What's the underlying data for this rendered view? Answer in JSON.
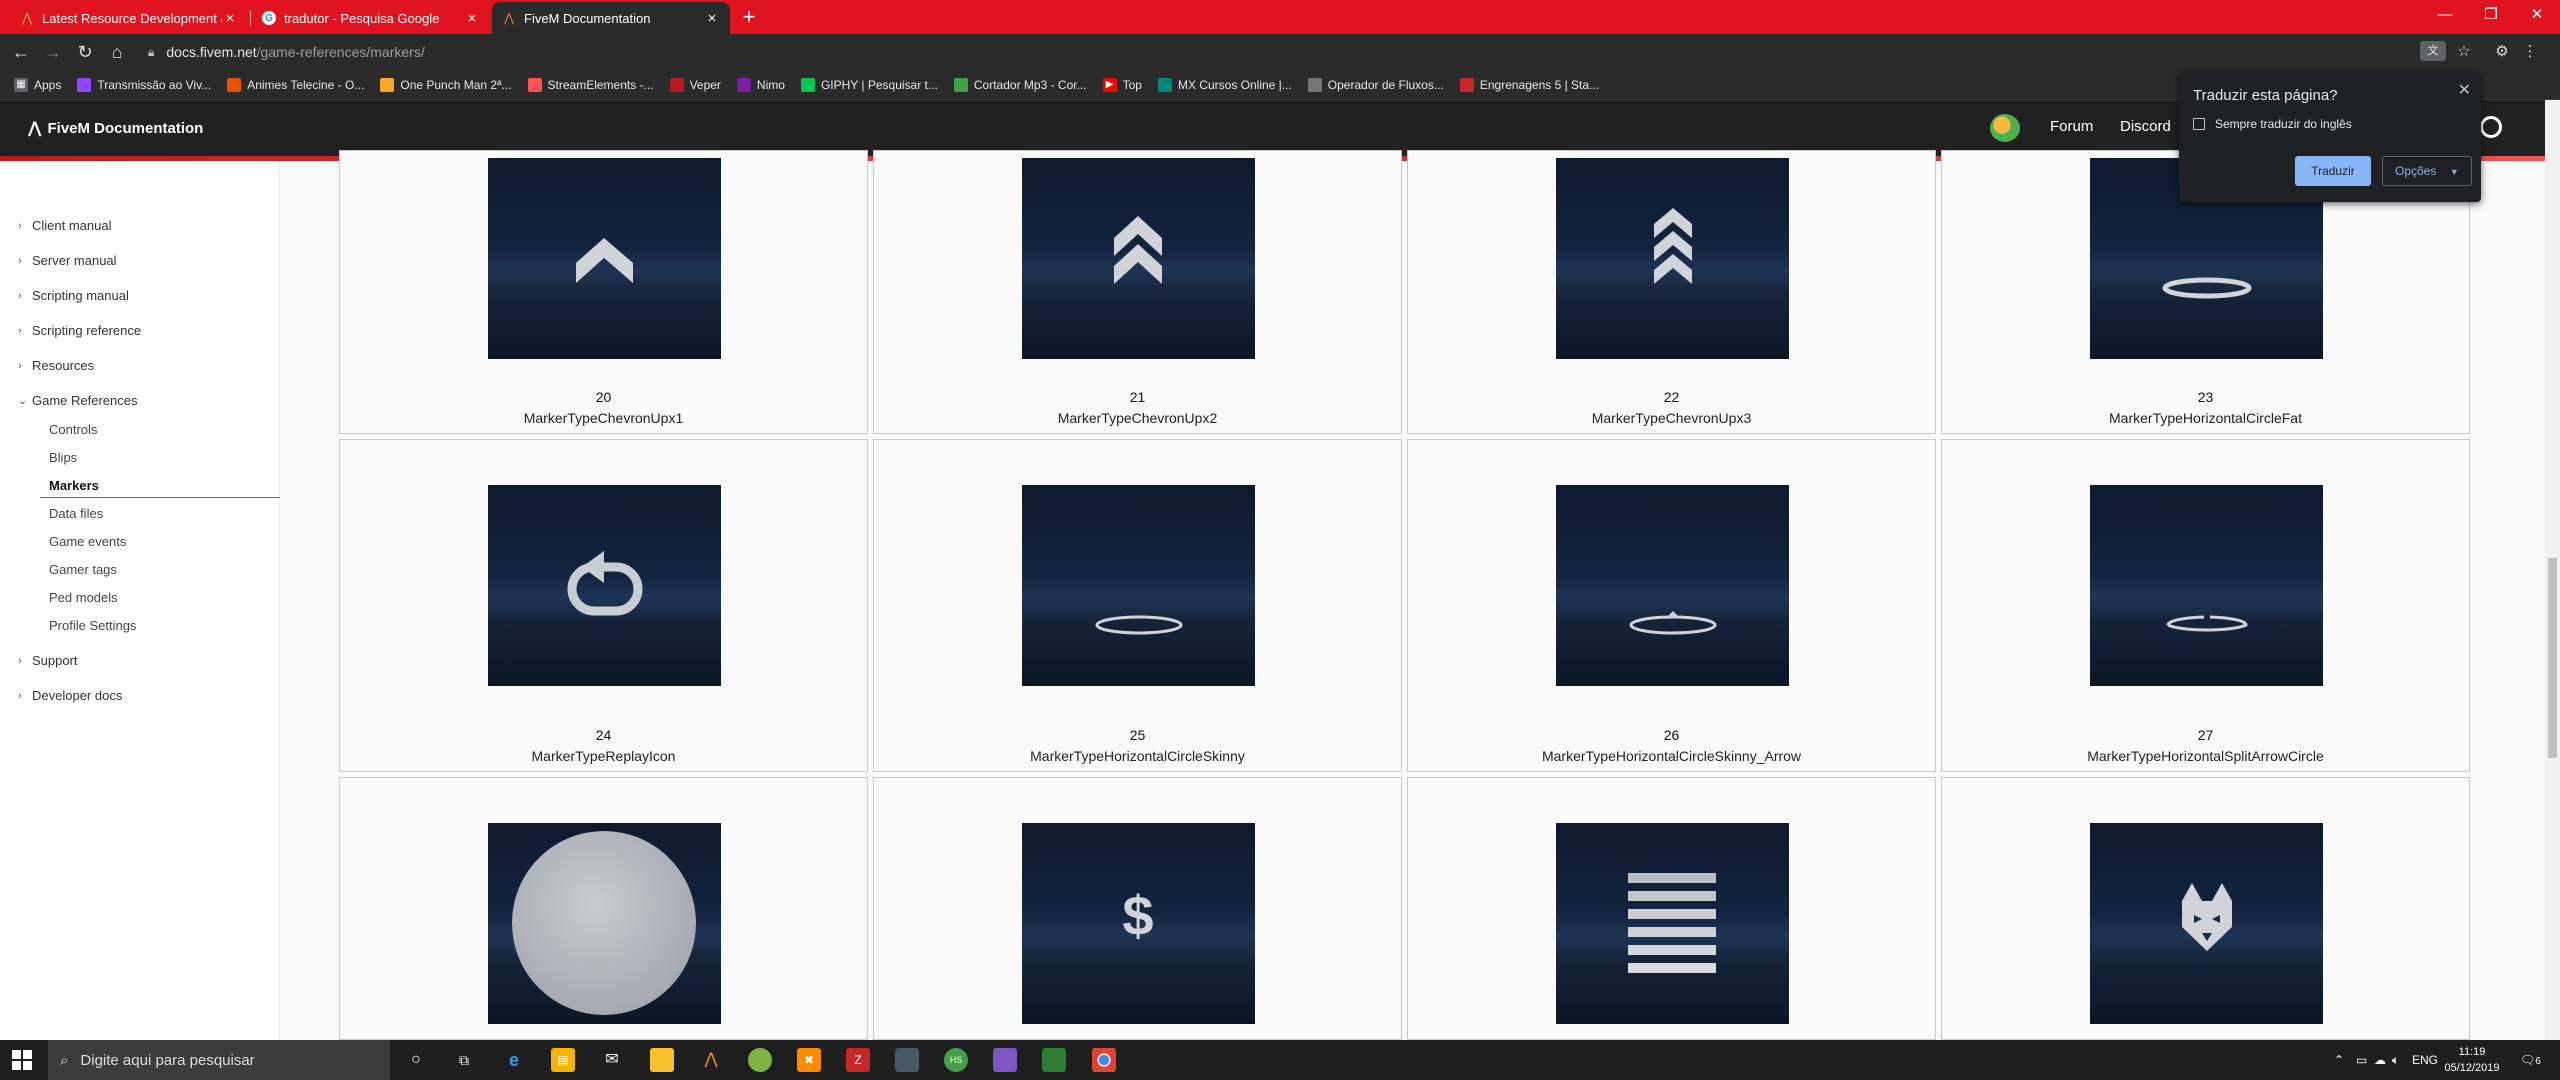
{
  "browser": {
    "tabs": [
      {
        "title": "Latest Resource Development &",
        "active": false
      },
      {
        "title": "tradutor - Pesquisa Google",
        "active": false
      },
      {
        "title": "FiveM Documentation",
        "active": true
      }
    ],
    "url_host": "docs.fivem.net",
    "url_path": "/game-references/markers/",
    "bookmarks": [
      {
        "label": "Apps",
        "color": "#5f6368"
      },
      {
        "label": "Transmissão ao Viv...",
        "color": "#9147ff"
      },
      {
        "label": "Animes Telecine - O...",
        "color": "#e65100"
      },
      {
        "label": "One Punch Man 2ª...",
        "color": "#f9a825"
      },
      {
        "label": "StreamElements -...",
        "color": "#ff5252"
      },
      {
        "label": "Veper",
        "color": "#b71c1c"
      },
      {
        "label": "Nimo",
        "color": "#7b1fa2"
      },
      {
        "label": "GIPHY | Pesquisar t...",
        "color": "#00c853"
      },
      {
        "label": "Cortador Mp3 - Cor...",
        "color": "#43a047"
      },
      {
        "label": "Top",
        "color": "#ff0000"
      },
      {
        "label": "MX Cursos Online |...",
        "color": "#00897b"
      },
      {
        "label": "Operador de Fluxos...",
        "color": "#757575"
      },
      {
        "label": "Engrenagens 5 | Sta...",
        "color": "#c62828"
      }
    ]
  },
  "site": {
    "brand": "FiveM Documentation",
    "nav": [
      "Forum",
      "Discord"
    ]
  },
  "sidebar": {
    "sections": [
      "Client manual",
      "Server manual",
      "Scripting manual",
      "Scripting reference",
      "Resources",
      "Game References",
      "Support",
      "Developer docs"
    ],
    "sub_items": [
      "Controls",
      "Blips",
      "Markers",
      "Data files",
      "Game events",
      "Gamer tags",
      "Ped models",
      "Profile Settings"
    ],
    "active": "Markers"
  },
  "markers": [
    {
      "id": "20",
      "name": "MarkerTypeChevronUpx1",
      "icon": "chevron-1"
    },
    {
      "id": "21",
      "name": "MarkerTypeChevronUpx2",
      "icon": "chevron-2"
    },
    {
      "id": "22",
      "name": "MarkerTypeChevronUpx3",
      "icon": "chevron-3"
    },
    {
      "id": "23",
      "name": "MarkerTypeHorizontalCircleFat",
      "icon": "ring-fat"
    },
    {
      "id": "24",
      "name": "MarkerTypeReplayIcon",
      "icon": "replay"
    },
    {
      "id": "25",
      "name": "MarkerTypeHorizontalCircleSkinny",
      "icon": "ring-skinny"
    },
    {
      "id": "26",
      "name": "MarkerTypeHorizontalCircleSkinny_Arrow",
      "icon": "ring-arrow"
    },
    {
      "id": "27",
      "name": "MarkerTypeHorizontalSplitArrowCircle",
      "icon": "ring-split"
    },
    {
      "id": "",
      "name": "",
      "icon": "sphere"
    },
    {
      "id": "",
      "name": "",
      "icon": "dollar"
    },
    {
      "id": "",
      "name": "",
      "icon": "stripes"
    },
    {
      "id": "",
      "name": "",
      "icon": "wolf"
    }
  ],
  "translate_popup": {
    "title": "Traduzir esta página?",
    "checkbox": "Sempre traduzir do inglês",
    "primary": "Traduzir",
    "secondary": "Opções"
  },
  "taskbar": {
    "search_placeholder": "Digite aqui para pesquisar",
    "lang": "ENG",
    "time": "11:19",
    "date": "05/12/2019",
    "notifications": "6"
  }
}
